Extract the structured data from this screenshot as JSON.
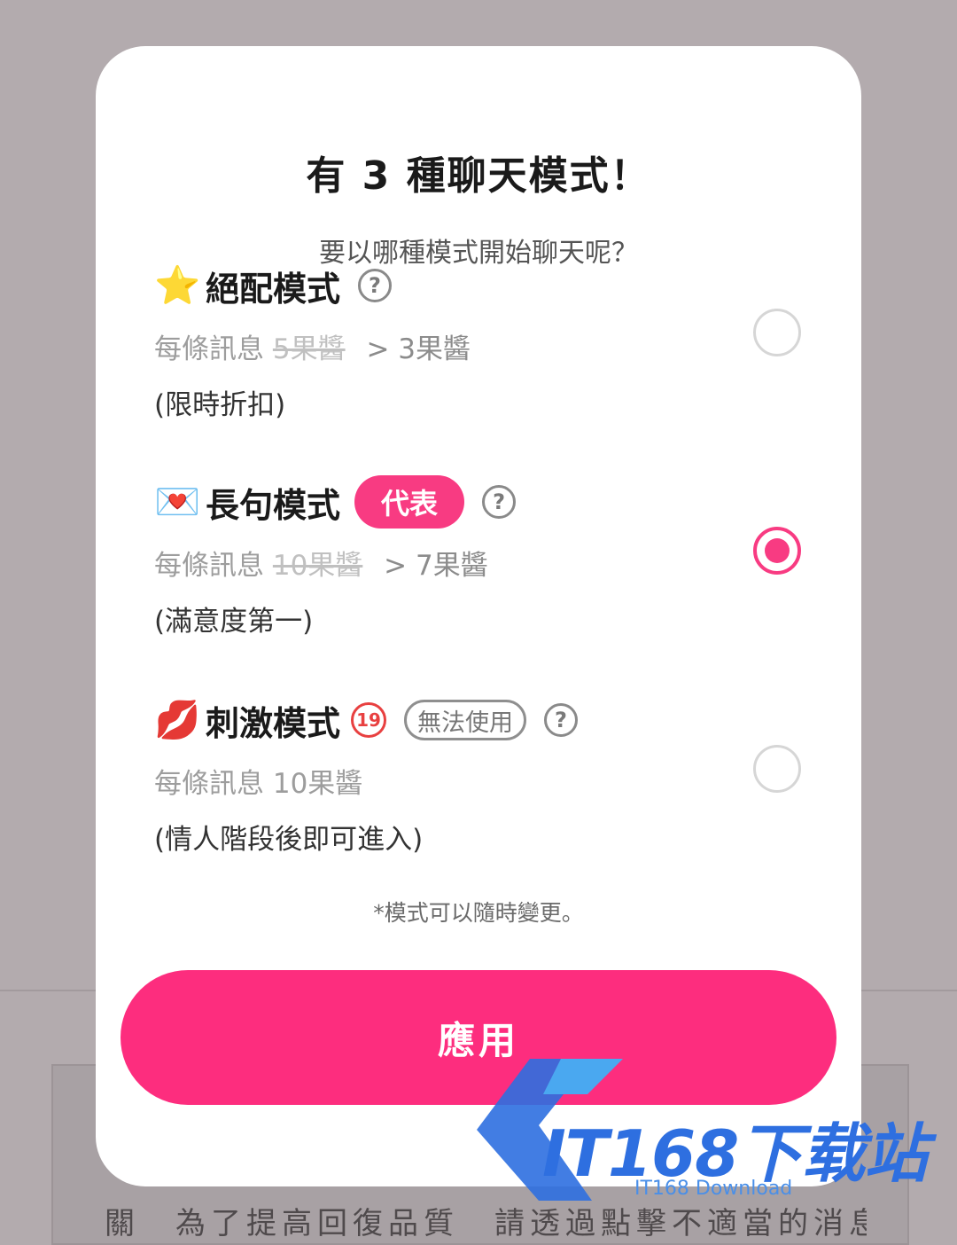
{
  "modal": {
    "title": "有 3 種聊天模式！",
    "subtitle": "要以哪種模式開始聊天呢？",
    "footnote": "*模式可以隨時變更。",
    "apply_label": "應用"
  },
  "modes": [
    {
      "emoji": "⭐",
      "name": "絕配模式",
      "help": "?",
      "price_prefix": "每條訊息",
      "old_price": "5果醬",
      "new_price": "> 3果醬",
      "note": "(限時折扣)",
      "selected": false
    },
    {
      "emoji": "💌",
      "name": "長句模式",
      "badge": "代表",
      "help": "?",
      "price_prefix": "每條訊息",
      "old_price": "10果醬",
      "new_price": "> 7果醬",
      "note": "(滿意度第一)",
      "selected": true
    },
    {
      "emoji": "💋",
      "name": "刺激模式",
      "age_badge": "19",
      "disabled_badge": "無法使用",
      "help": "?",
      "price": "每條訊息 10果醬",
      "note": "(情人階段後即可進入)",
      "selected": false
    }
  ],
  "background": {
    "text": "關　為了提高回復品質　請透過點擊不適當的消息"
  },
  "watermark": {
    "text": "IT168下载站",
    "sub": "IT168 Download"
  },
  "colors": {
    "accent": "#fd2d7e",
    "overlay": "#b3abae"
  }
}
